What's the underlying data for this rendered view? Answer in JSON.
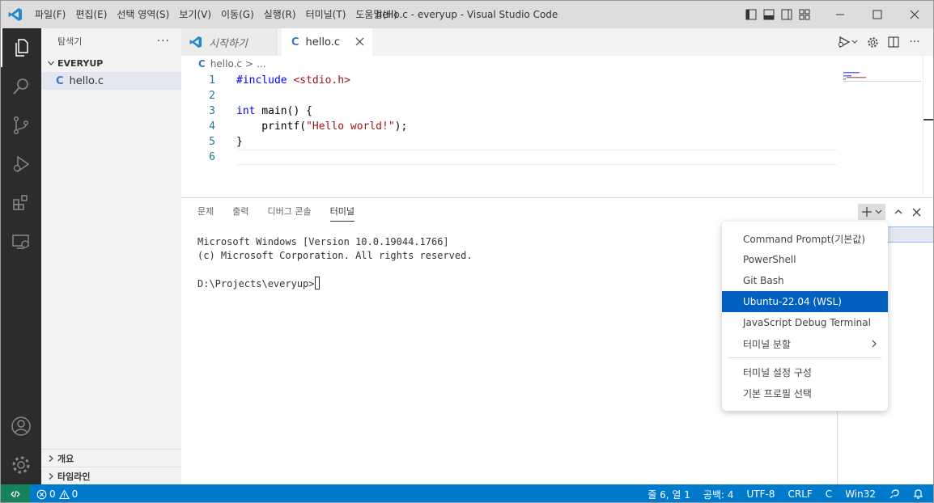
{
  "titlebar": {
    "title": "hello.c - everyup - Visual Studio Code",
    "menu": [
      "파일(F)",
      "편집(E)",
      "선택 영역(S)",
      "보기(V)",
      "이동(G)",
      "실행(R)",
      "터미널(T)",
      "도움말(H)"
    ]
  },
  "sidebar": {
    "title": "탐색기",
    "folder": "EVERYUP",
    "file": "hello.c",
    "file_icon": "C",
    "outline": "개요",
    "timeline": "타임라인"
  },
  "tabs": {
    "welcome": "시작하기",
    "active": "hello.c",
    "active_icon": "C"
  },
  "breadcrumb": {
    "file": "hello.c",
    "sep": ">",
    "more": "..."
  },
  "editor": {
    "lines": [
      {
        "n": "1",
        "parts": [
          {
            "t": "#include",
            "c": "tk-dir"
          },
          {
            "t": " ",
            "c": ""
          },
          {
            "t": "<stdio.h>",
            "c": "tk-inc"
          }
        ]
      },
      {
        "n": "2",
        "parts": []
      },
      {
        "n": "3",
        "parts": [
          {
            "t": "int",
            "c": "tk-kw"
          },
          {
            "t": " main() {",
            "c": ""
          }
        ]
      },
      {
        "n": "4",
        "parts": [
          {
            "t": "    printf(",
            "c": ""
          },
          {
            "t": "\"Hello world!\"",
            "c": "tk-str"
          },
          {
            "t": ");",
            "c": ""
          }
        ]
      },
      {
        "n": "5",
        "parts": [
          {
            "t": "}",
            "c": ""
          }
        ]
      },
      {
        "n": "6",
        "parts": []
      }
    ]
  },
  "panel": {
    "tabs": [
      "문제",
      "출력",
      "디버그 콘솔",
      "터미널"
    ],
    "active_tab": "터미널",
    "terminal_lines": [
      "Microsoft Windows [Version 10.0.19044.1766]",
      "(c) Microsoft Corporation. All rights reserved.",
      "",
      "D:\\Projects\\everyup>"
    ]
  },
  "dropdown": {
    "profiles": [
      "Command Prompt(기본값)",
      "PowerShell",
      "Git Bash",
      "Ubuntu-22.04 (WSL)",
      "JavaScript Debug Terminal"
    ],
    "selected": "Ubuntu-22.04 (WSL)",
    "split": "터미널 분할",
    "configure": "터미널 설정 구성",
    "default_profile": "기본 프로필 선택"
  },
  "statusbar": {
    "errors": "0",
    "warnings": "0",
    "position": "줄 6, 열 1",
    "spaces": "공백: 4",
    "encoding": "UTF-8",
    "eol": "CRLF",
    "language": "C",
    "platform": "Win32"
  },
  "colors": {
    "statusbar": "#007acc",
    "remote": "#16825d",
    "activitybar": "#2c2c2c",
    "selection": "#0060c0"
  }
}
